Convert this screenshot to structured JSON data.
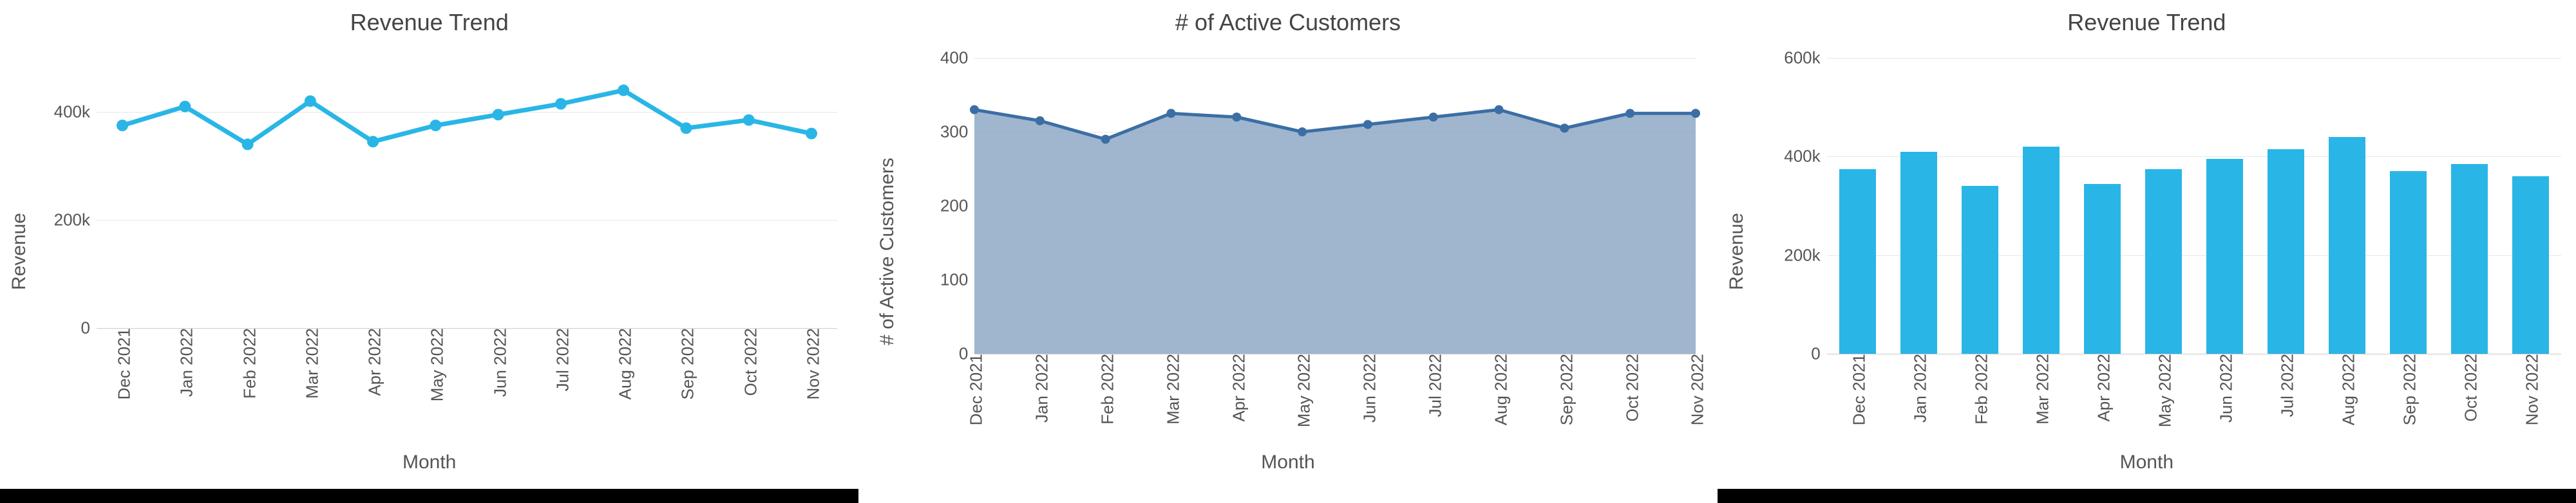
{
  "charts": [
    {
      "id": "revenue-line",
      "title": "Revenue Trend",
      "xlabel": "Month",
      "ylabel": "Revenue",
      "type": "line"
    },
    {
      "id": "customers-area",
      "title": "# of Active Customers",
      "xlabel": "Month",
      "ylabel": "# of Active Customers",
      "type": "area"
    },
    {
      "id": "revenue-bar",
      "title": "Revenue Trend",
      "xlabel": "Month",
      "ylabel": "Revenue",
      "type": "bar"
    }
  ],
  "chart_data": [
    {
      "type": "line",
      "title": "Revenue Trend",
      "xlabel": "Month",
      "ylabel": "Revenue",
      "categories": [
        "Dec 2021",
        "Jan 2022",
        "Feb 2022",
        "Mar 2022",
        "Apr 2022",
        "May 2022",
        "Jun 2022",
        "Jul 2022",
        "Aug 2022",
        "Sep 2022",
        "Oct 2022",
        "Nov 2022"
      ],
      "values": [
        375000,
        410000,
        340000,
        420000,
        345000,
        375000,
        395000,
        415000,
        440000,
        370000,
        385000,
        360000
      ],
      "yticks": [
        0,
        200000,
        400000
      ],
      "ytick_labels": [
        "0",
        "200k",
        "400k"
      ],
      "ylim": [
        0,
        500000
      ],
      "color": "#29b6e6"
    },
    {
      "type": "area",
      "title": "# of Active Customers",
      "xlabel": "Month",
      "ylabel": "# of Active Customers",
      "categories": [
        "Dec 2021",
        "Jan 2022",
        "Feb 2022",
        "Mar 2022",
        "Apr 2022",
        "May 2022",
        "Jun 2022",
        "Jul 2022",
        "Aug 2022",
        "Sep 2022",
        "Oct 2022",
        "Nov 2022"
      ],
      "values": [
        330,
        315,
        290,
        325,
        320,
        300,
        310,
        320,
        330,
        305,
        325,
        325
      ],
      "yticks": [
        0,
        100,
        200,
        300,
        400
      ],
      "ytick_labels": [
        "0",
        "100",
        "200",
        "300",
        "400"
      ],
      "ylim": [
        0,
        400
      ],
      "line_color": "#3b6ea5",
      "fill_color": "#8fa9c6"
    },
    {
      "type": "bar",
      "title": "Revenue Trend",
      "xlabel": "Month",
      "ylabel": "Revenue",
      "categories": [
        "Dec 2021",
        "Jan 2022",
        "Feb 2022",
        "Mar 2022",
        "Apr 2022",
        "May 2022",
        "Jun 2022",
        "Jul 2022",
        "Aug 2022",
        "Sep 2022",
        "Oct 2022",
        "Nov 2022"
      ],
      "values": [
        375000,
        410000,
        340000,
        420000,
        345000,
        375000,
        395000,
        415000,
        440000,
        370000,
        385000,
        360000
      ],
      "yticks": [
        0,
        200000,
        400000,
        600000
      ],
      "ytick_labels": [
        "0",
        "200k",
        "400k",
        "600k"
      ],
      "ylim": [
        0,
        600000
      ],
      "color": "#29b6e6"
    }
  ]
}
